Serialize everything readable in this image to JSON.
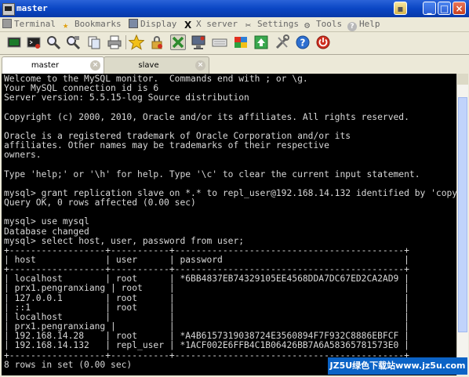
{
  "window": {
    "title": "master"
  },
  "menu": [
    {
      "label": "Terminal",
      "icon": "terminal-icon"
    },
    {
      "label": "Bookmarks",
      "icon": "bookmark-icon"
    },
    {
      "label": "Display",
      "icon": "display-icon"
    },
    {
      "label": "X server",
      "icon": "x-icon"
    },
    {
      "label": "Settings",
      "icon": "settings-icon"
    },
    {
      "label": "Tools",
      "icon": "tools-icon"
    },
    {
      "label": "Help",
      "icon": "help-icon"
    }
  ],
  "toolbar": [
    {
      "name": "new-session-icon",
      "color": "#1c7a2a"
    },
    {
      "name": "new-terminal-icon",
      "color": "#333333"
    },
    {
      "name": "search-icon",
      "color": "#4a4a4a"
    },
    {
      "name": "find-icon",
      "color": "#4a4a4a"
    },
    {
      "name": "copy-icon",
      "color": "#5a6d8a"
    },
    {
      "name": "print-icon",
      "color": "#6b6b6b"
    },
    {
      "name": "bookmark-star-icon",
      "color": "#e8b40c"
    },
    {
      "name": "lock-icon",
      "color": "#c89a2a"
    },
    {
      "name": "x-server-icon",
      "color": "#2d8a2d"
    },
    {
      "name": "display-monitor-icon",
      "color": "#6a7890"
    },
    {
      "name": "keyboard-icon",
      "color": "#7a7a7a"
    },
    {
      "name": "color-palette-icon",
      "color": "#d04a2a"
    },
    {
      "name": "upload-icon",
      "color": "#2b9a3e"
    },
    {
      "name": "settings-tools-icon",
      "color": "#7a7a7a"
    },
    {
      "name": "help-icon",
      "color": "#2d6fd0"
    },
    {
      "name": "power-icon",
      "color": "#d03020"
    }
  ],
  "tabs": [
    {
      "label": "master",
      "active": true
    },
    {
      "label": "slave",
      "active": false
    }
  ],
  "terminal": {
    "colors": {
      "background": "#000000",
      "text": "#d8d8d8"
    },
    "lines": [
      "Welcome to the MySQL monitor.  Commands end with ; or \\g.",
      "Your MySQL connection id is 6",
      "Server version: 5.5.15-log Source distribution",
      "",
      "Copyright (c) 2000, 2010, Oracle and/or its affiliates. All rights reserved.",
      "",
      "Oracle is a registered trademark of Oracle Corporation and/or its",
      "affiliates. Other names may be trademarks of their respective",
      "owners.",
      "",
      "Type 'help;' or '\\h' for help. Type '\\c' to clear the current input statement.",
      "",
      "mysql> grant replication slave on *.* to repl_user@192.168.14.132 identified by 'copy'",
      "Query OK, 0 rows affected (0.00 sec)",
      "",
      "mysql> use mysql",
      "Database changed",
      "mysql> select host, user, password from user;",
      "+------------------+-----------+-------------------------------------------+",
      "| host             | user      | password                                  |",
      "+------------------+-----------+-------------------------------------------+",
      "| localhost        | root      | *6BB4837EB74329105EE4568DDA7DC67ED2CA2AD9 |",
      "| prx1.pengranxiang | root     |                                           |",
      "| 127.0.0.1        | root      |                                           |",
      "| ::1              | root      |                                           |",
      "| localhost        |           |                                           |",
      "| prx1.pengranxiang |          |                                           |",
      "| 192.168.14.28    | root      | *A4B6157319038724E3560894F7F932C8886EBFCF |",
      "| 192.168.14.132   | repl_user | *1ACF002E6FFB4C1B06426BB7A6A58365781573E0 |",
      "+------------------+-----------+-------------------------------------------+",
      "8 rows in set (0.00 sec)"
    ]
  },
  "watermark": {
    "text": "JZ5U绿色下载站www.jz5u.com"
  }
}
